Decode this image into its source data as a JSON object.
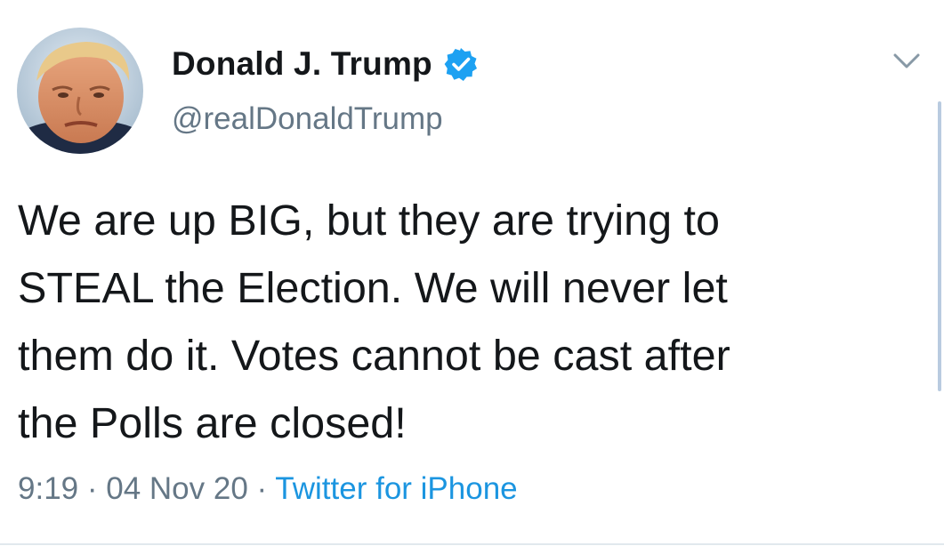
{
  "user": {
    "display_name": "Donald J. Trump",
    "handle": "@realDonaldTrump",
    "verified": true,
    "avatar_icon": "profile-photo-icon"
  },
  "tweet": {
    "lines": [
      "We are up BIG, but they are trying to",
      "STEAL the Election. We will never let",
      "them do it. Votes cannot be cast after",
      "the Polls are closed!"
    ]
  },
  "meta": {
    "time": "9:19",
    "separator": "·",
    "date": "04 Nov 20",
    "source": "Twitter for iPhone"
  },
  "colors": {
    "text": "#14171a",
    "secondary": "#657786",
    "accent": "#1b95e0",
    "verified": "#1da1f2"
  }
}
